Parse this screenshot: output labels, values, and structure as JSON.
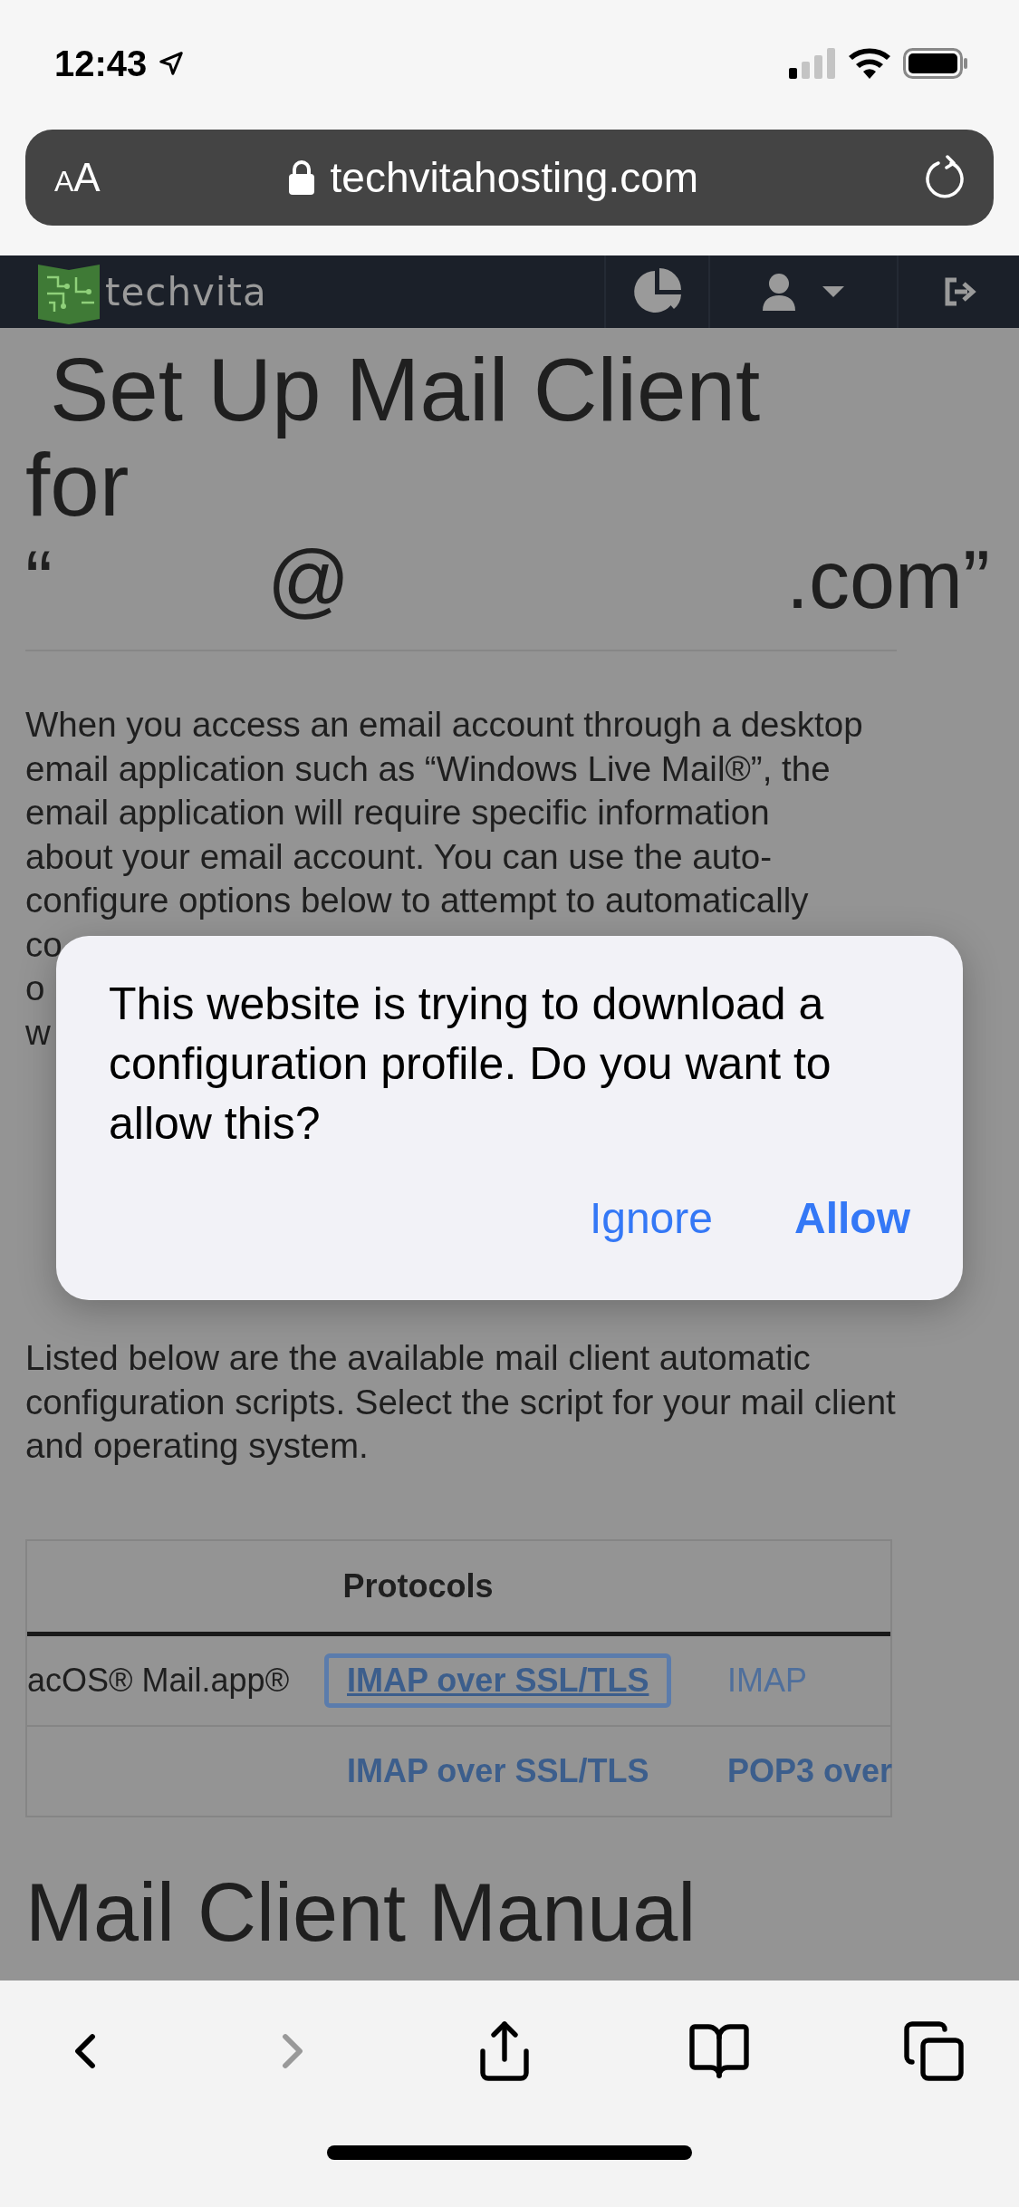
{
  "status_bar": {
    "time": "12:43"
  },
  "address_bar": {
    "text_size_button": "AA",
    "url": "techvitahosting.com"
  },
  "site_nav": {
    "logo_text": "techvita"
  },
  "heading": {
    "lines": [
      "Set Up Mail Client",
      "for"
    ],
    "address_parts": [
      "“",
      "@",
      ".com”"
    ]
  },
  "intro_lines": [
    "When you access an email account through a desktop",
    "email application such as “Windows Live Mail®”, the",
    "email application will require specific information",
    "about your email account. You can use the auto-",
    "configure options below to attempt to automatically",
    "co",
    "o",
    "w"
  ],
  "section_text": "Listed below are the available mail client automatic configuration scripts. Select the script for your mail client and operating system.",
  "table": {
    "header": "Protocols",
    "rows": [
      {
        "cells": [
          {
            "kind": "text",
            "text": "acOS® Mail.app®"
          },
          {
            "kind": "link",
            "text": "IMAP over SSL/TLS",
            "bold": true,
            "focused": true
          },
          {
            "kind": "link",
            "text": "IMAP",
            "bold": false,
            "focused": false
          }
        ]
      },
      {
        "cells": [
          {
            "kind": "blank"
          },
          {
            "kind": "link",
            "text": "IMAP over SSL/TLS",
            "bold": true,
            "focused": false
          },
          {
            "kind": "link",
            "text": "POP3 over",
            "bold": true,
            "focused": false
          }
        ]
      }
    ]
  },
  "manual_heading": "Mail Client Manual",
  "dialog": {
    "message": "This website is trying to download a configuration profile. Do you want to allow this?",
    "buttons": [
      {
        "label": "Ignore",
        "primary": false
      },
      {
        "label": "Allow",
        "primary": true
      }
    ]
  },
  "toolbar": {
    "back_enabled": true,
    "forward_enabled": false
  }
}
